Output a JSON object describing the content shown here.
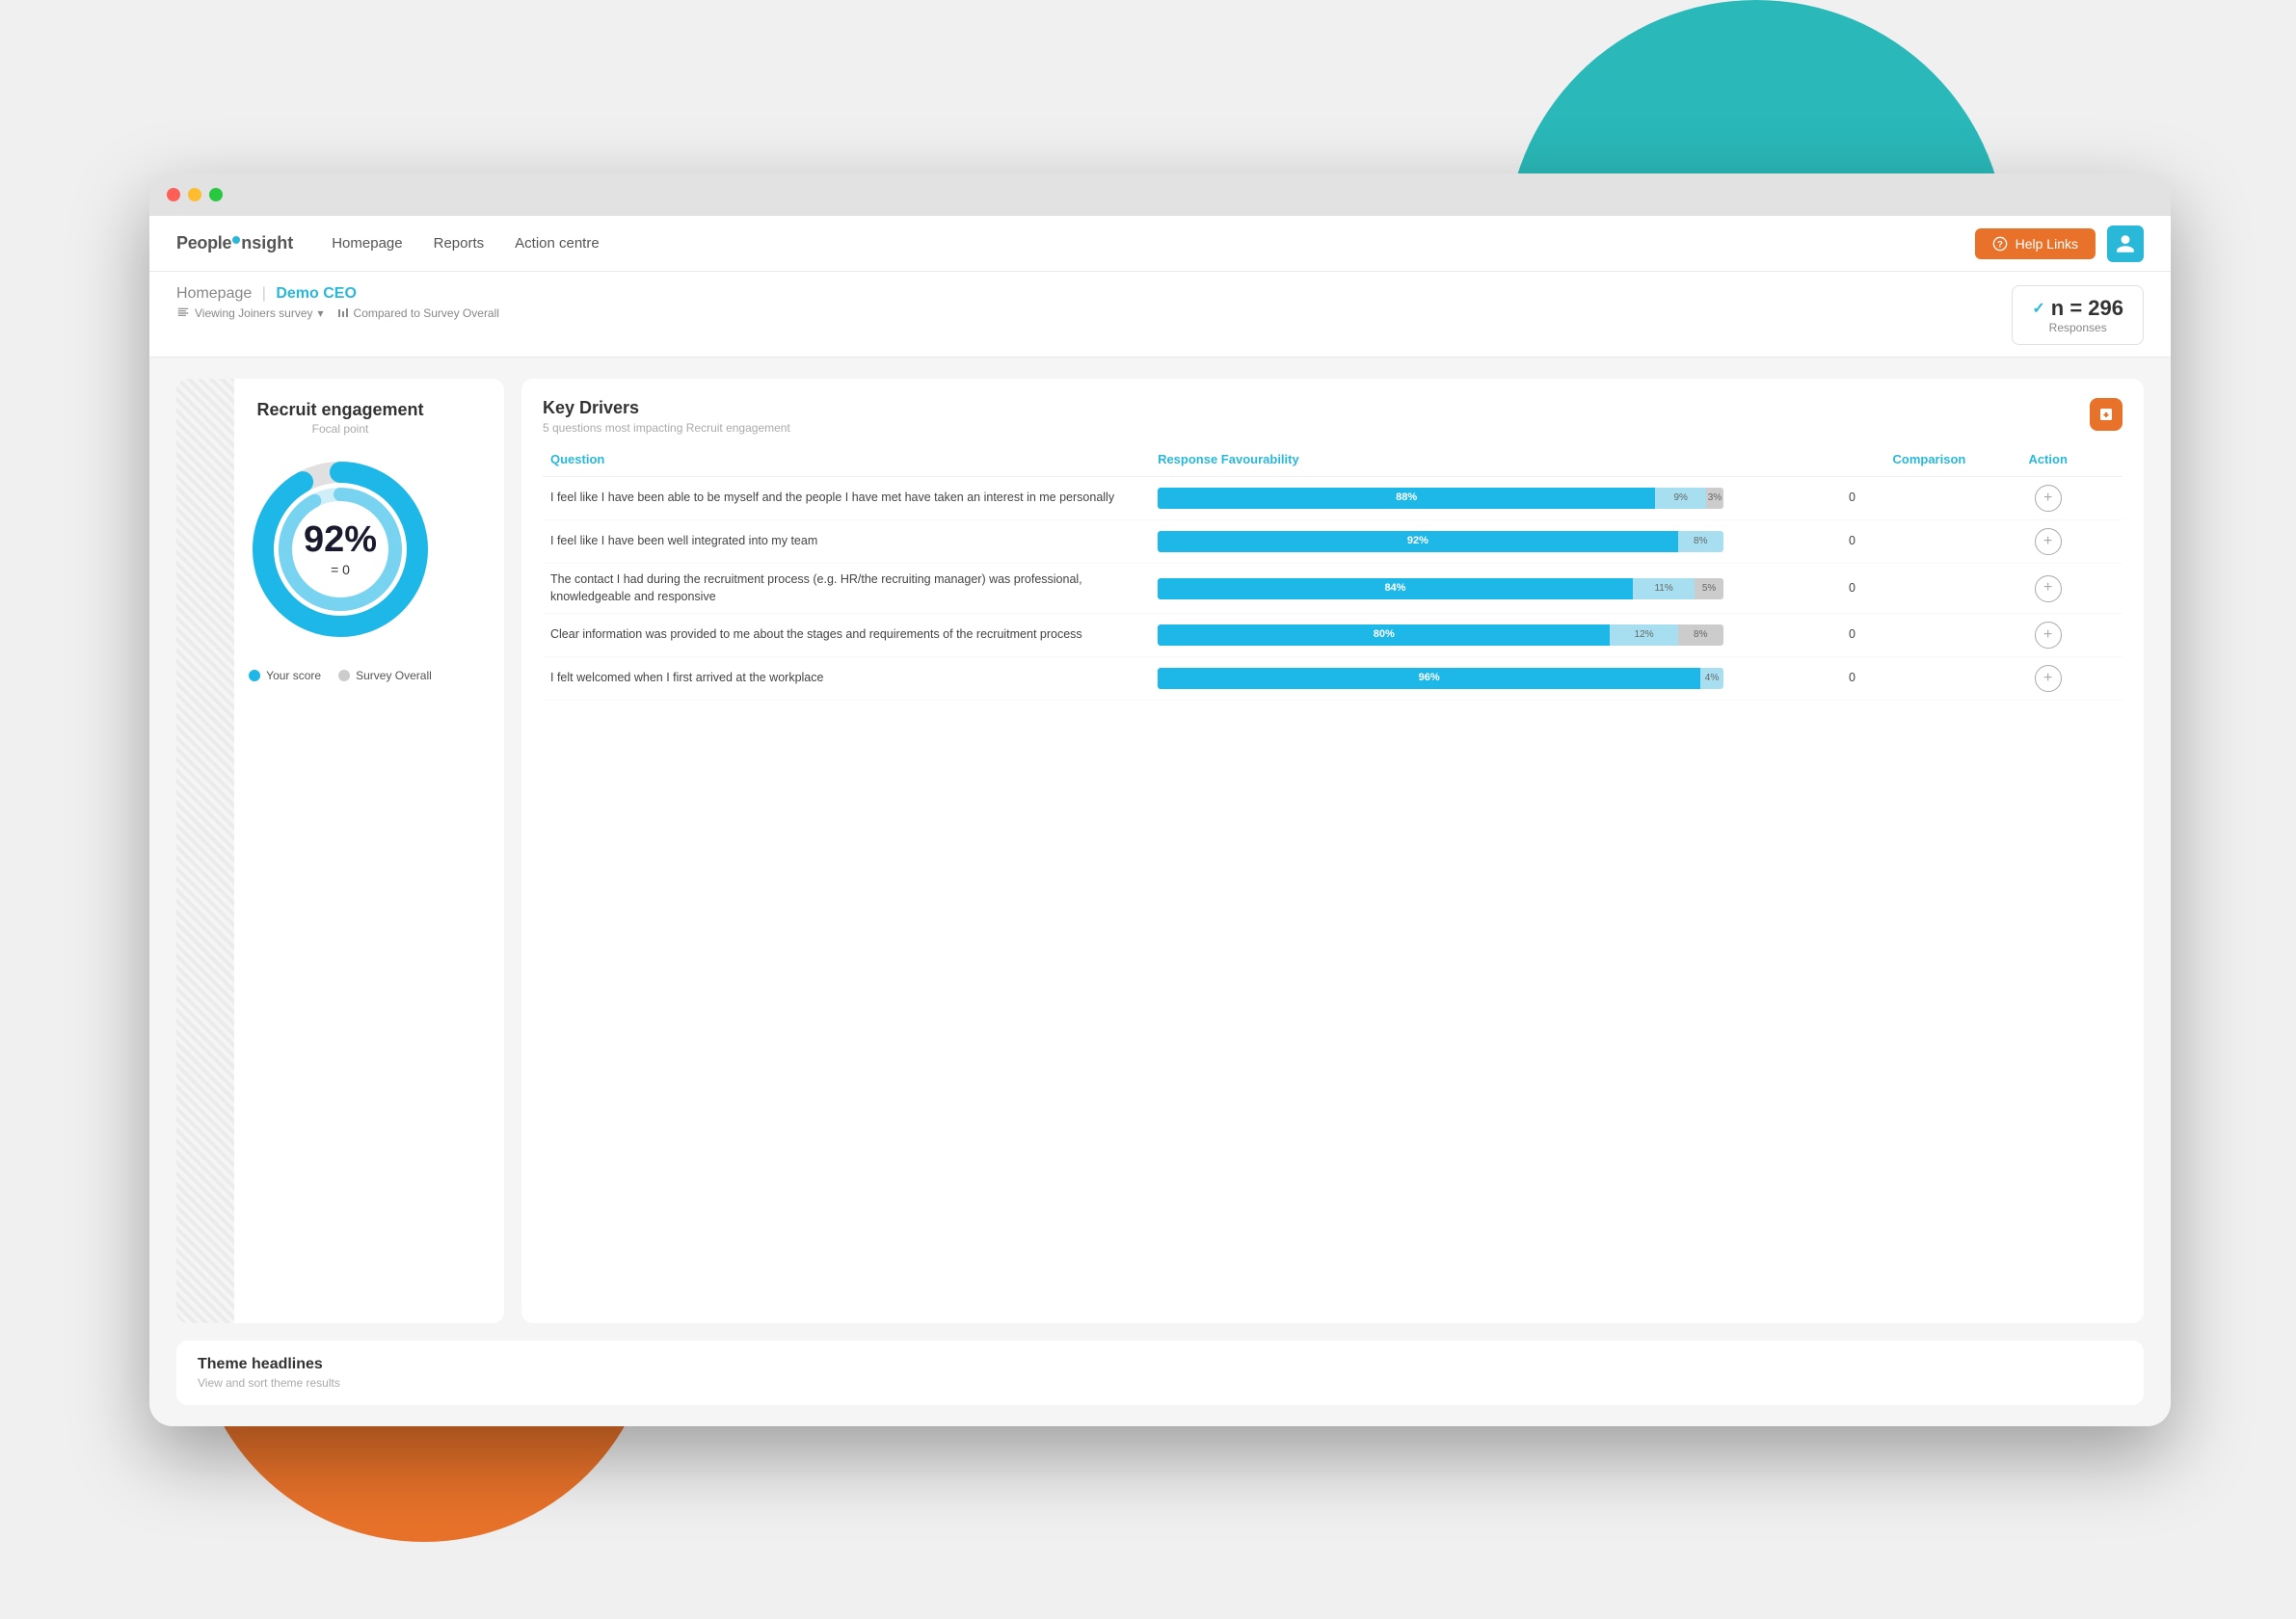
{
  "background": {
    "teal_color": "#2ab8b8",
    "orange_color": "#e8722a"
  },
  "browser": {
    "title_bar": {
      "controls": [
        "red",
        "yellow",
        "green"
      ]
    }
  },
  "nav": {
    "logo": "PeopleInsight",
    "links": [
      "Homepage",
      "Reports",
      "Action centre"
    ],
    "help_button": "Help Links",
    "user_avatar_label": "User"
  },
  "breadcrumb": {
    "prefix": "Homepage",
    "separator": "|",
    "user": "Demo CEO",
    "survey_label": "Viewing Joiners survey",
    "comparison_label": "Compared to Survey Overall",
    "responses_n": "n = 296",
    "responses_label": "Responses"
  },
  "recruit_card": {
    "title": "Recruit engagement",
    "subtitle": "Focal point",
    "percent": "92%",
    "equals": "= 0",
    "legend_your_score": "Your score",
    "legend_survey_overall": "Survey Overall"
  },
  "key_drivers": {
    "title": "Key Drivers",
    "subtitle": "5 questions most impacting Recruit engagement",
    "col_question": "Question",
    "col_favourability": "Response Favourability",
    "col_comparison": "Comparison",
    "col_action": "Action",
    "rows": [
      {
        "question": "I feel like I have been able to be myself and the people I have met have taken an interest in me personally",
        "blue_pct": 88,
        "light_blue_pct": 9,
        "gray_pct": 3,
        "blue_label": "88%",
        "light_label": "9%",
        "gray_label": "3%",
        "comparison": "0"
      },
      {
        "question": "I feel like I have been well integrated into my team",
        "blue_pct": 92,
        "light_blue_pct": 8,
        "gray_pct": 0,
        "blue_label": "92%",
        "light_label": "8%",
        "gray_label": "",
        "comparison": "0"
      },
      {
        "question": "The contact I had during the recruitment process (e.g. HR/the recruiting manager) was professional, knowledgeable and responsive",
        "blue_pct": 84,
        "light_blue_pct": 11,
        "gray_pct": 5,
        "blue_label": "84%",
        "light_label": "11%",
        "gray_label": "5%",
        "comparison": "0"
      },
      {
        "question": "Clear information was provided to me about the stages and requirements of the recruitment process",
        "blue_pct": 80,
        "light_blue_pct": 12,
        "gray_pct": 8,
        "blue_label": "80%",
        "light_label": "12%",
        "gray_label": "8%",
        "comparison": "0"
      },
      {
        "question": "I felt welcomed when I first arrived at the workplace",
        "blue_pct": 96,
        "light_blue_pct": 4,
        "gray_pct": 0,
        "blue_label": "96%",
        "light_label": "4%",
        "gray_label": "",
        "comparison": "0"
      }
    ]
  },
  "theme_headlines": {
    "title": "Theme headlines",
    "subtitle": "View and sort theme results"
  }
}
